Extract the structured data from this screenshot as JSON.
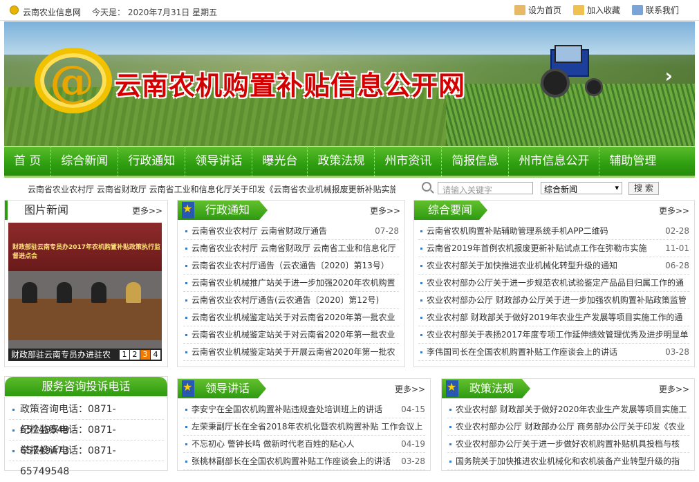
{
  "topbar": {
    "site": "云南农业信息网",
    "today": "今天是： 2020年7月31日 星期五",
    "links": [
      "设为首页",
      "加入收藏",
      "联系我们"
    ]
  },
  "banner": {
    "title": "云南农机购置补贴信息公开网"
  },
  "nav": [
    "首 页",
    "综合新闻",
    "行政通知",
    "领导讲话",
    "曝光台",
    "政策法规",
    "州市资讯",
    "简报信息",
    "州市信息公开",
    "辅助管理"
  ],
  "ticker": "云南省农业农村厅 云南省财政厅 云南省工业和信息化厅关于印发《云南省农业机械报废更新补贴实施",
  "search": {
    "placeholder": "请输入关键字",
    "category": "综合新闻",
    "button": "搜 索"
  },
  "photo_news": {
    "title": "图片新闻",
    "more": "更多>>",
    "caption": "财政部驻云南专员办进驻农",
    "banner_text": "财政部驻云南专员办2017年农机购置补贴政策执行监督进点会",
    "pages": [
      "1",
      "2",
      "3",
      "4"
    ]
  },
  "admin_notice": {
    "title": "行政通知",
    "more": "更多>>",
    "items": [
      {
        "t": "云南省农业农村厅 云南省财政厅通告",
        "d": "07-28"
      },
      {
        "t": "云南省农业农村厅 云南省财政厅 云南省工业和信息化厅",
        "d": ""
      },
      {
        "t": "云南省农业农村厅通告（云农通告〔2020〕第13号）",
        "d": ""
      },
      {
        "t": "云南省农业机械推广站关于进一步加强2020年农机购置",
        "d": ""
      },
      {
        "t": "云南省农业农村厅通告(云农通告〔2020〕第12号)",
        "d": ""
      },
      {
        "t": "云南省农业机械鉴定站关于对云南省2020年第一批农业",
        "d": ""
      },
      {
        "t": "云南省农业机械鉴定站关于对云南省2020年第一批农业",
        "d": ""
      },
      {
        "t": "云南省农业机械鉴定站关于开展云南省2020年第一批农",
        "d": ""
      }
    ]
  },
  "general_news": {
    "title": "综合要闻",
    "more": "更多>>",
    "items": [
      {
        "t": "云南省农机购置补贴辅助管理系统手机APP二维码",
        "d": "02-28"
      },
      {
        "t": "云南省2019年首例农机报废更新补贴试点工作在弥勒市实施",
        "d": "11-01"
      },
      {
        "t": "农业农村部关于加快推进农业机械化转型升级的通知",
        "d": "06-28"
      },
      {
        "t": "农业农村部办公厅关于进一步规范农机试验鉴定产品品目归属工作的通",
        "d": ""
      },
      {
        "t": "农业农村部办公厅 财政部办公厅关于进一步加强农机购置补贴政策监管",
        "d": ""
      },
      {
        "t": "农业农村部 财政部关于做好2019年农业生产发展等项目实施工作的通",
        "d": ""
      },
      {
        "t": "农业农村部关于表扬2017年度专项工作延伸绩效管理优秀及进步明显单",
        "d": ""
      },
      {
        "t": "李伟国司长在全国农机购置补贴工作座谈会上的讲话",
        "d": "03-28"
      }
    ]
  },
  "service": {
    "title": "服务咨询投诉电话",
    "items": [
      "政策咨询电话：0871-65749549",
      "纪检监察电话：0871-65749473",
      "举报投诉电话：0871-65749548"
    ]
  },
  "leader_speech": {
    "title": "领导讲话",
    "more": "更多>>",
    "items": [
      {
        "t": "李安宁在全国农机购置补贴违规查处培训班上的讲话",
        "d": "04-15"
      },
      {
        "t": "左荣秉副厅长在全省2018年农机化暨农机购置补贴 工作会议上",
        "d": ""
      },
      {
        "t": "不忘初心 警钟长鸣 做新时代老百姓的贴心人",
        "d": "04-19"
      },
      {
        "t": "张桃林副部长在全国农机购置补贴工作座谈会上的讲话",
        "d": "03-28"
      }
    ]
  },
  "policy": {
    "title": "政策法规",
    "more": "更多>>",
    "items": [
      {
        "t": "农业农村部 财政部关于做好2020年农业生产发展等项目实施工",
        "d": ""
      },
      {
        "t": "农业农村部办公厅 财政部办公厅 商务部办公厅关于印发《农业",
        "d": ""
      },
      {
        "t": "农业农村部办公厅关于进一步做好农机购置补贴机具投档与核",
        "d": ""
      },
      {
        "t": "国务院关于加快推进农业机械化和农机装备产业转型升级的指",
        "d": ""
      }
    ]
  }
}
